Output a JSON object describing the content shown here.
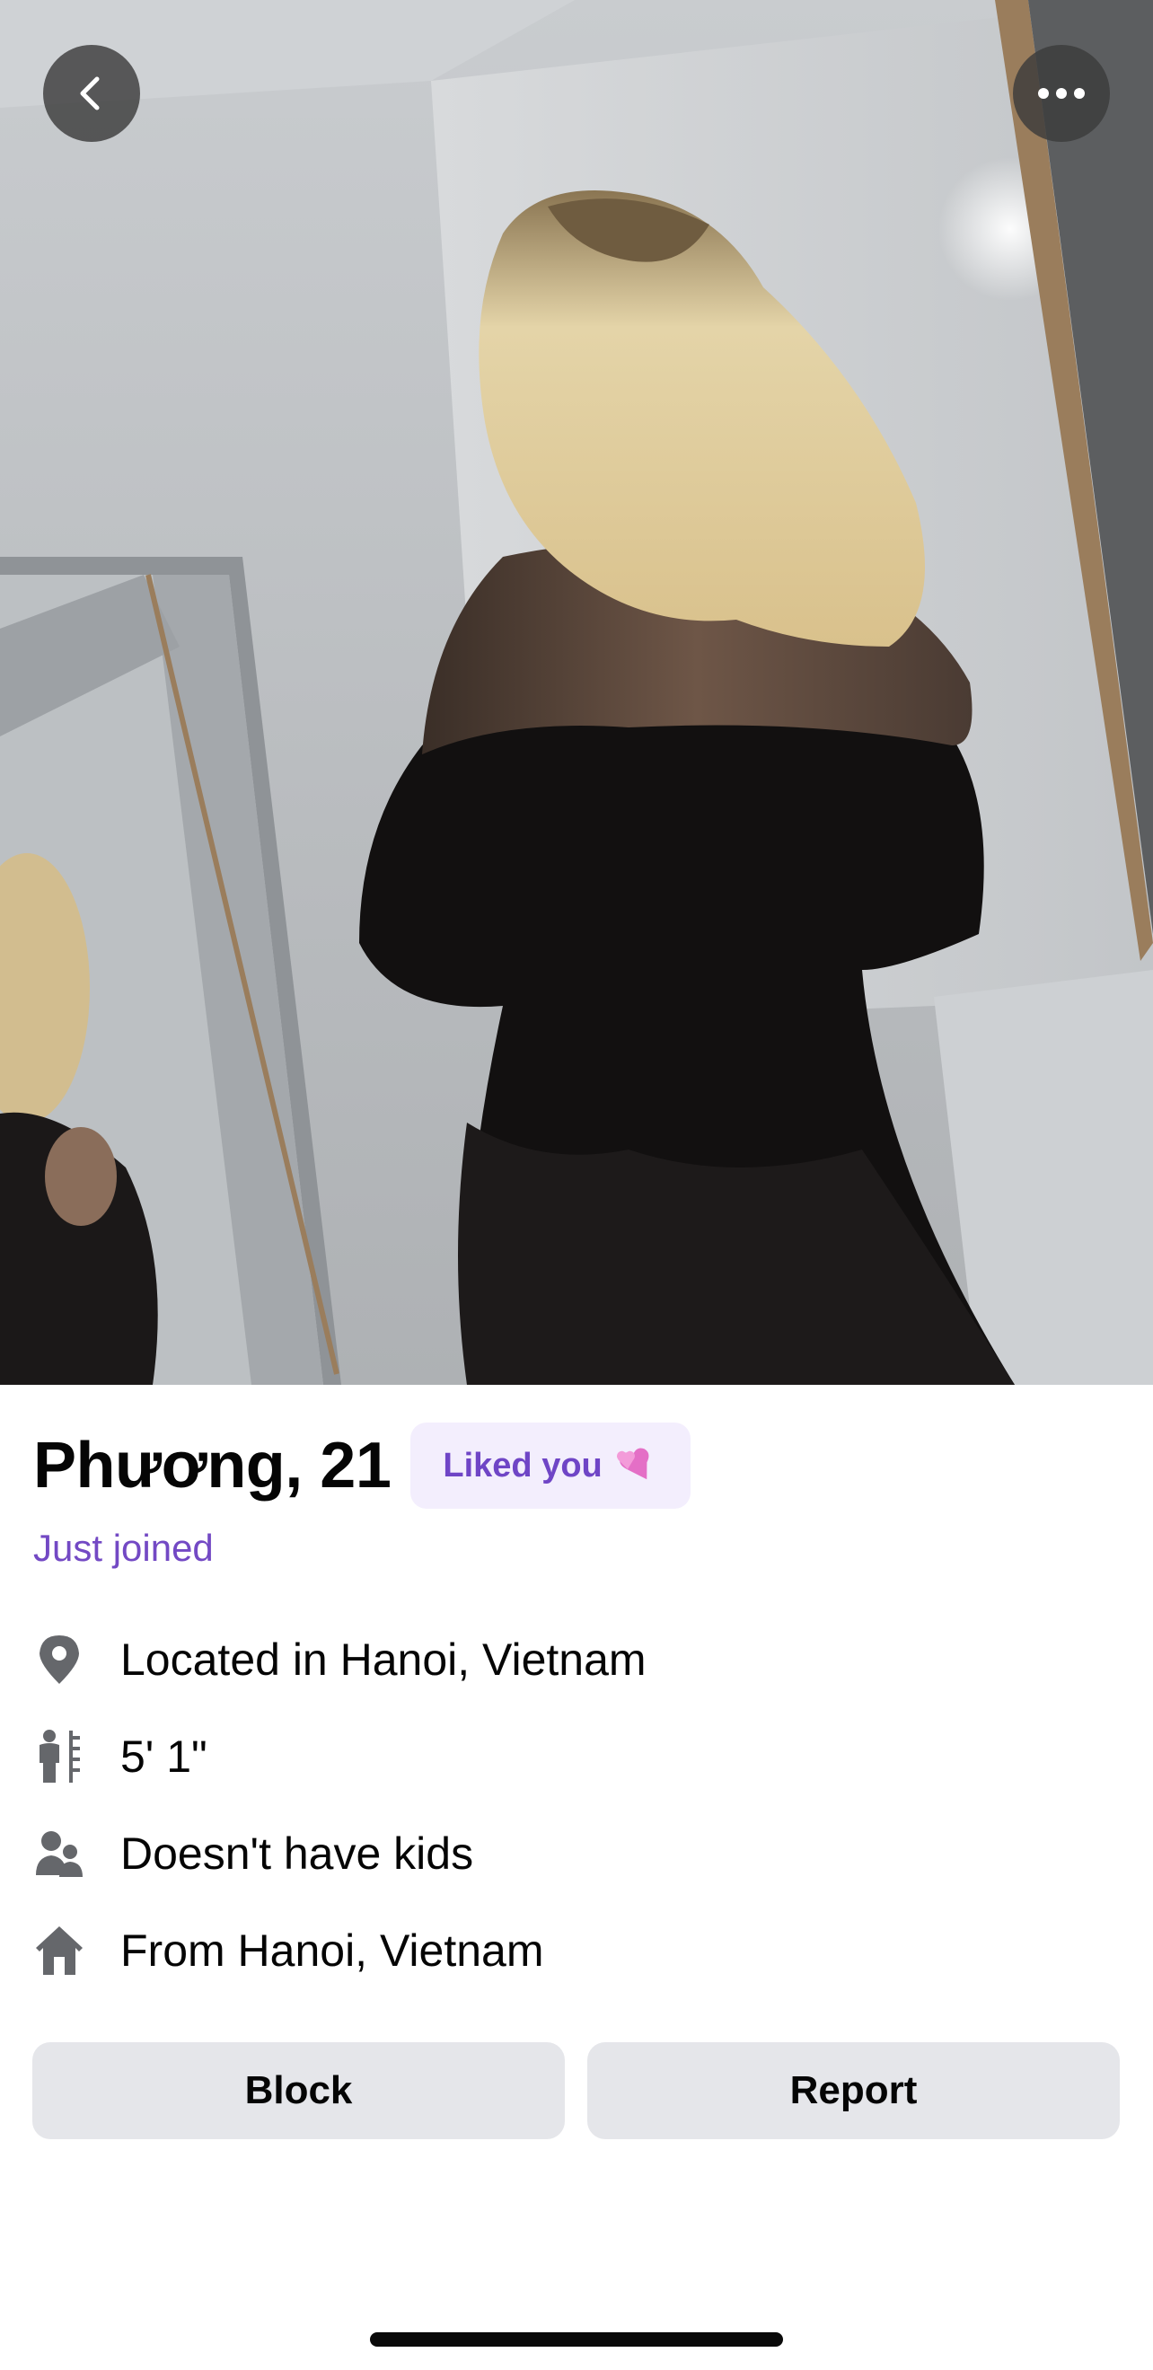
{
  "profile": {
    "name_age": "Phương, 21",
    "liked_badge": "Liked you",
    "status": "Just joined"
  },
  "details": [
    {
      "icon": "location-pin-icon",
      "text": "Located in Hanoi, Vietnam"
    },
    {
      "icon": "height-icon",
      "text": "5' 1\""
    },
    {
      "icon": "people-icon",
      "text": "Doesn't have kids"
    },
    {
      "icon": "home-icon",
      "text": "From Hanoi, Vietnam"
    }
  ],
  "actions": {
    "block_label": "Block",
    "report_label": "Report"
  },
  "colors": {
    "accent_purple": "#7349c4",
    "badge_background": "#f3eefd",
    "button_gray": "#e5e6ea",
    "icon_gray": "#65676b"
  }
}
